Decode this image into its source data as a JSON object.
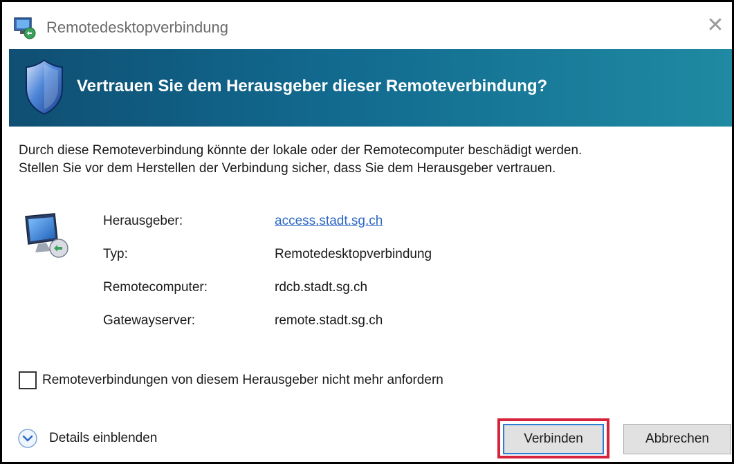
{
  "window": {
    "title": "Remotedesktopverbindung",
    "close_glyph": "✕"
  },
  "banner": {
    "question": "Vertrauen Sie dem Herausgeber dieser Remoteverbindung?",
    "accent": "#126a8f"
  },
  "warning": {
    "line1": "Durch diese Remoteverbindung könnte der lokale oder der Remotecomputer beschädigt werden.",
    "line2": "Stellen Sie vor dem Herstellen der Verbindung sicher, dass Sie dem Herausgeber vertrauen."
  },
  "info": {
    "publisher_label": "Herausgeber:",
    "publisher_value": "access.stadt.sg.ch",
    "type_label": "Typ:",
    "type_value": "Remotedesktopverbindung",
    "remote_label": "Remotecomputer:",
    "remote_value": "rdcb.stadt.sg.ch",
    "gateway_label": "Gatewayserver:",
    "gateway_value": "remote.stadt.sg.ch"
  },
  "checkbox": {
    "label": "Remoteverbindungen von diesem Herausgeber nicht mehr anfordern",
    "checked": false
  },
  "details": {
    "label": "Details einblenden"
  },
  "buttons": {
    "connect": "Verbinden",
    "cancel": "Abbrechen",
    "highlight_color": "#d6223a"
  },
  "icons": {
    "app": "remote-desktop-icon",
    "shield": "shield-icon",
    "monitor": "monitor-icon",
    "expand": "chevron-down-icon"
  }
}
